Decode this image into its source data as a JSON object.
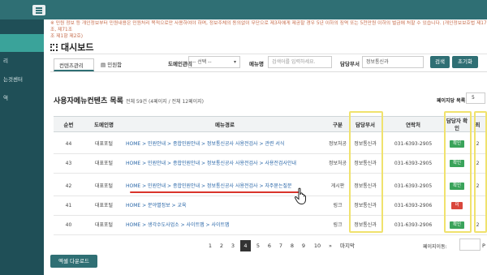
{
  "notice": "※ 민원 정보 등 개인정보부터 민원내용은 민원처리 목적으로만 사용하여야 하며, 정보주체의 동의없이 무단으로 제3자에게 제공할 경우 5년 이하의 징역 또는 5천만원 이하의 벌금에 처할 수 있습니다. (개인정보보호법 제17조, 제71조",
  "notice_line2": "조 제1항 제2호)",
  "sidebar": {
    "items": [
      {
        "label": ""
      },
      {
        "label": "리"
      },
      {
        "label": "는것센터"
      },
      {
        "label": "역"
      }
    ]
  },
  "dashboard": {
    "title": "대시보드"
  },
  "tabs": [
    {
      "label": "컨텐츠관리"
    },
    {
      "label": "민원함"
    }
  ],
  "filters": {
    "division_label": "도메인관리",
    "division_value": "-- 선택 --",
    "menu_label": "메뉴명",
    "menu_placeholder": "검색어를 입력하세요.",
    "dept_label": "담당부서",
    "dept_value": "정보통신과",
    "search_button": "검색",
    "reset_button": "초기화"
  },
  "list": {
    "title": "사용자메뉴컨텐츠 목록",
    "count": "전체 59건 (4페이지 / 전체 12페이지)",
    "page_rows_label": "페이지당 목록",
    "page_rows_value": "5"
  },
  "table": {
    "headers": [
      "순번",
      "도메인명",
      "메뉴경로",
      "구분",
      "담당부서",
      "연락처",
      "담당자 확인",
      "최"
    ],
    "rows": [
      {
        "no": "44",
        "domain": "대표포털",
        "path": "HOME > 민원안내 > 종합민원안내 > 정보통신공사 사용전검사 > 관련 서식",
        "type": "정보처공",
        "dept": "정보통신과",
        "phone": "031-6393-2905",
        "confirm": "확인",
        "status": "ok",
        "last": "2"
      },
      {
        "no": "43",
        "domain": "대표포털",
        "path": "HOME > 민원안내 > 종합민원안내 > 정보통신공사 사용전검사 > 사용전검사안내",
        "type": "정보처공",
        "dept": "정보통신과",
        "phone": "031-6393-2905",
        "confirm": "확인",
        "status": "ok",
        "last": "2"
      },
      {
        "no": "42",
        "domain": "대표포털",
        "path": "HOME > 민원안내 > 종합민원안내 > 정보통신공사 사용전검사 > 자주묻는질문",
        "type": "게시판",
        "dept": "정보통신과",
        "phone": "031-6393-2905",
        "confirm": "확인",
        "status": "ok",
        "last": "2"
      },
      {
        "no": "41",
        "domain": "대표포털",
        "path": "HOME > 분야별정보 > 교육",
        "type": "링크",
        "dept": "정보통신과",
        "phone": "031-6393-2906",
        "confirm": "미",
        "status": "no",
        "last": ""
      },
      {
        "no": "40",
        "domain": "대표포털",
        "path": "HOME > 생각수도사업소 > 사이트맵 > 사이트맵",
        "type": "링크",
        "dept": "정보통신과",
        "phone": "031-6393-2906",
        "confirm": "확인",
        "status": "ok",
        "last": "2"
      }
    ]
  },
  "pagination": {
    "pages": [
      "1",
      "2",
      "3",
      "4",
      "5",
      "6",
      "7",
      "8",
      "9",
      "10"
    ],
    "current": "4",
    "next": "»",
    "last": "마지막",
    "jump_label": "페이지이동:",
    "go": "P"
  },
  "excel_button": "엑셀 다운로드",
  "colors": {
    "topbar": "#2f6f74",
    "sidebar": "#1f4f57",
    "active": "#3aa39a",
    "highlight": "#f0e26d",
    "red_underline": "#d9342b"
  }
}
